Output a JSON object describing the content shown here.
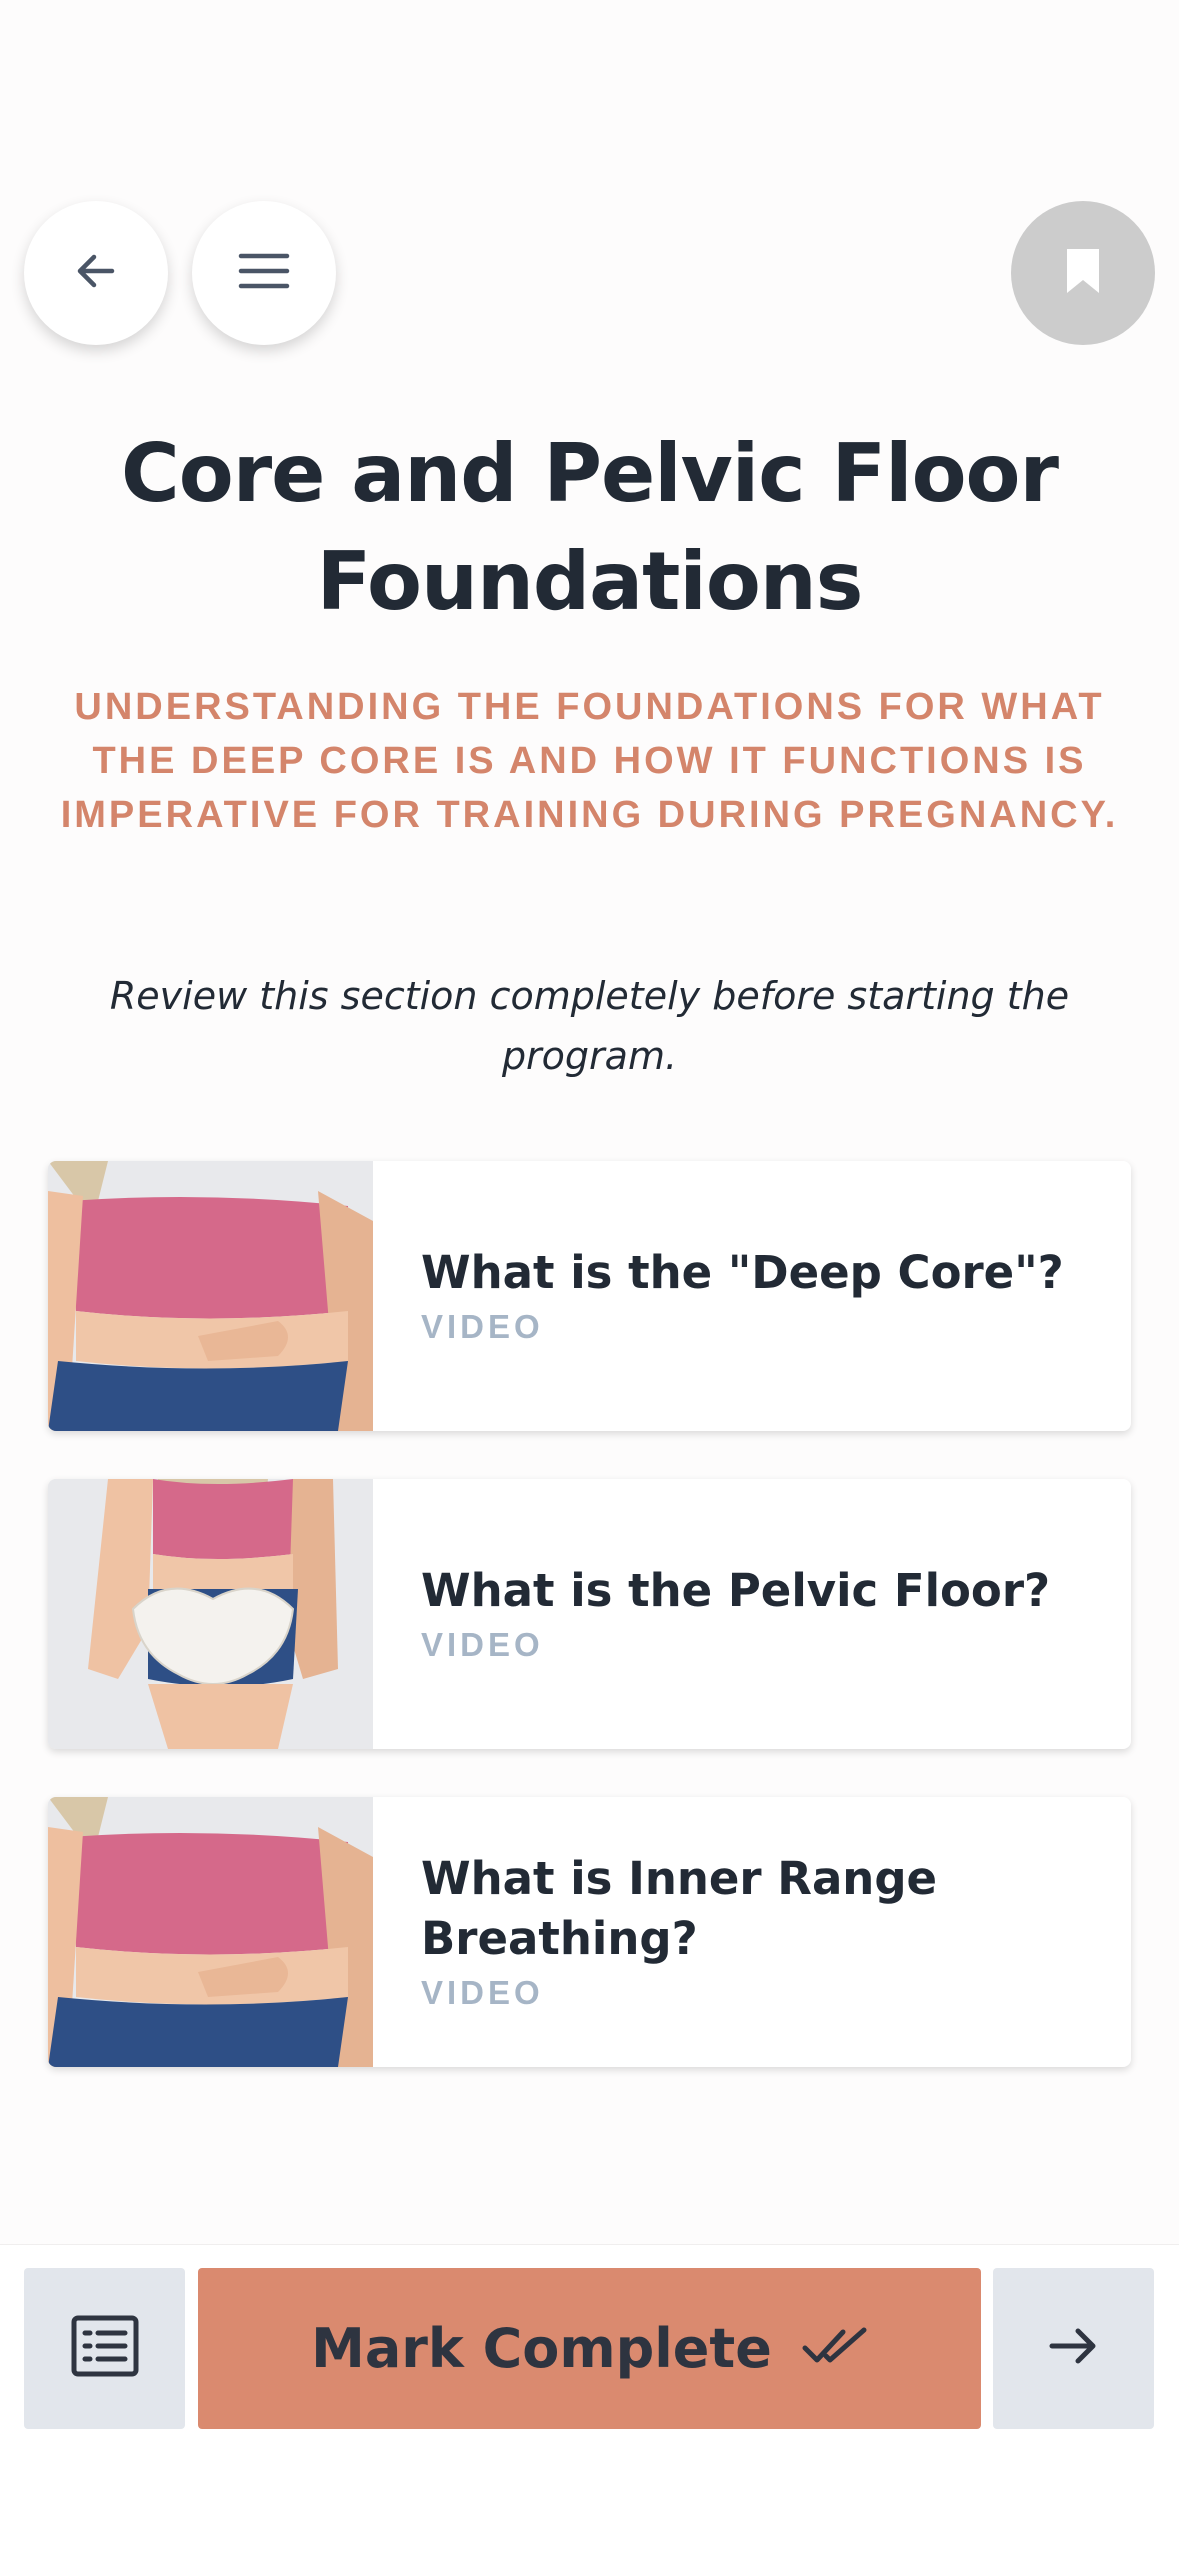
{
  "header": {
    "back_icon": "arrow-left-icon",
    "menu_icon": "hamburger-menu-icon",
    "bookmark_icon": "bookmark-icon"
  },
  "lesson": {
    "title": "Core and Pelvic Floor Foundations",
    "subtitle": "UNDERSTANDING THE FOUNDATIONS FOR WHAT THE DEEP CORE IS AND HOW IT FUNCTIONS IS IMPERATIVE FOR TRAINING DURING PREGNANCY.",
    "note": "Review this section completely before starting the program."
  },
  "items": [
    {
      "title": "What is the \"Deep Core\"?",
      "type": "VIDEO"
    },
    {
      "title": "What is the Pelvic Floor?",
      "type": "VIDEO"
    },
    {
      "title": "What is Inner Range Breathing?",
      "type": "VIDEO"
    }
  ],
  "footer": {
    "list_icon": "list-icon",
    "mark_complete_label": "Mark Complete",
    "check_icon": "double-check-icon",
    "next_icon": "arrow-right-icon"
  },
  "colors": {
    "accent": "#da8a6f",
    "subtitle": "#d4856b",
    "tag": "#a6b5c6",
    "text": "#222a35",
    "bookmark_bg": "#cccccc",
    "secondary_btn": "#e2e6ec"
  }
}
